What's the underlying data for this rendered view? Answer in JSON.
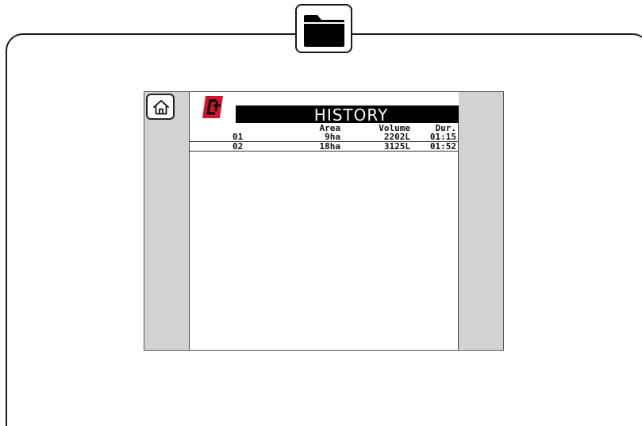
{
  "header": {
    "folder_icon": "folder-icon"
  },
  "screen": {
    "home_icon": "home-icon",
    "logo_icon": "brand-logo-icon",
    "title": "HISTORY",
    "columns": {
      "area": "Area",
      "volume": "Volume",
      "duration": "Dur."
    },
    "rows": [
      {
        "id": "01",
        "area": "9ha",
        "volume": "2202L",
        "duration": "01:15"
      },
      {
        "id": "02",
        "area": "18ha",
        "volume": "3125L",
        "duration": "01:52"
      }
    ]
  },
  "colors": {
    "logo_red": "#d4142a",
    "title_bg": "#000000",
    "side_panel": "#d2d2d2"
  }
}
